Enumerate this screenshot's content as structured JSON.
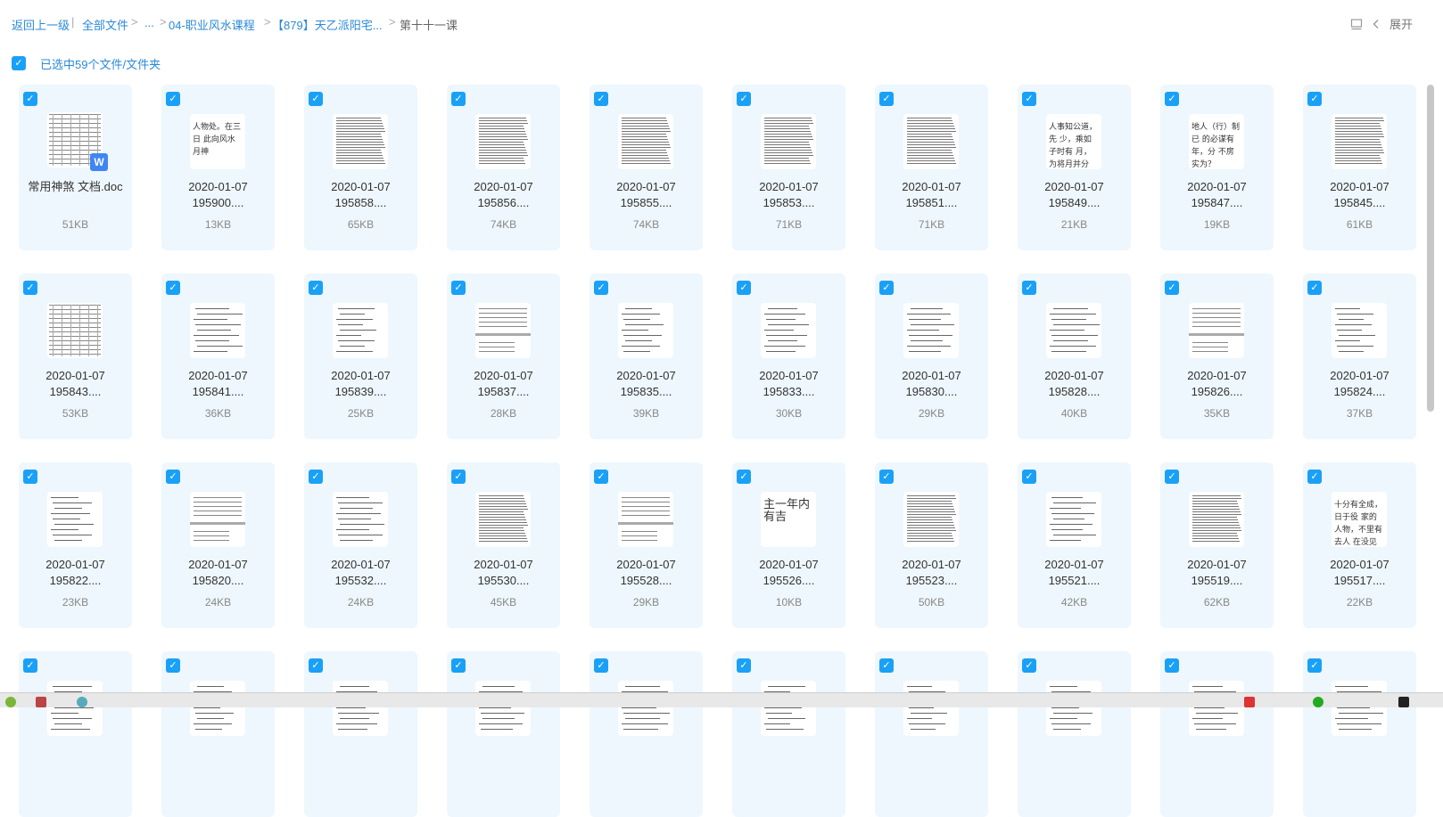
{
  "breadcrumb": {
    "back": "返回上一级",
    "sep1": "|",
    "all_files": "全部文件",
    "ellipsis": "...",
    "folder1": "04-职业风水课程",
    "folder2": "【879】天乙派阳宅...",
    "current": "第十十一课",
    "arrow": ">"
  },
  "header": {
    "expand_label": "展开",
    "layout_icon": "layout-icon",
    "chevron_icon": "chevron-left-icon"
  },
  "selection": {
    "text": "已选中59个文件/文件夹",
    "checked": true
  },
  "files": [
    {
      "name": "常用神煞 文档.doc",
      "size": "51KB",
      "type": "doc",
      "preview": "table"
    },
    {
      "name": "2020-01-07 195900....",
      "size": "13KB",
      "type": "image",
      "preview": "big",
      "text": "人物处。在三日 此向风水月神"
    },
    {
      "name": "2020-01-07 195858....",
      "size": "65KB",
      "type": "image",
      "preview": "dense"
    },
    {
      "name": "2020-01-07 195856....",
      "size": "74KB",
      "type": "image",
      "preview": "dense"
    },
    {
      "name": "2020-01-07 195855....",
      "size": "74KB",
      "type": "image",
      "preview": "dense"
    },
    {
      "name": "2020-01-07 195853....",
      "size": "71KB",
      "type": "image",
      "preview": "dense"
    },
    {
      "name": "2020-01-07 195851....",
      "size": "71KB",
      "type": "image",
      "preview": "dense"
    },
    {
      "name": "2020-01-07 195849....",
      "size": "21KB",
      "type": "image",
      "preview": "big",
      "text": "人事知公道，先 少，乘如子时有 月，为将月并分"
    },
    {
      "name": "2020-01-07 195847....",
      "size": "19KB",
      "type": "image",
      "preview": "big",
      "text": "地人（行）制已 的必谋有年，分 不房实为？"
    },
    {
      "name": "2020-01-07 195845....",
      "size": "61KB",
      "type": "image",
      "preview": "dense"
    },
    {
      "name": "2020-01-07 195843....",
      "size": "53KB",
      "type": "image",
      "preview": "table"
    },
    {
      "name": "2020-01-07 195841....",
      "size": "36KB",
      "type": "image",
      "preview": "sparse"
    },
    {
      "name": "2020-01-07 195839....",
      "size": "25KB",
      "type": "image",
      "preview": "sparse"
    },
    {
      "name": "2020-01-07 195837....",
      "size": "28KB",
      "type": "image",
      "preview": "bar"
    },
    {
      "name": "2020-01-07 195835....",
      "size": "39KB",
      "type": "image",
      "preview": "sparse"
    },
    {
      "name": "2020-01-07 195833....",
      "size": "30KB",
      "type": "image",
      "preview": "sparse"
    },
    {
      "name": "2020-01-07 195830....",
      "size": "29KB",
      "type": "image",
      "preview": "sparse"
    },
    {
      "name": "2020-01-07 195828....",
      "size": "40KB",
      "type": "image",
      "preview": "sparse"
    },
    {
      "name": "2020-01-07 195826....",
      "size": "35KB",
      "type": "image",
      "preview": "bar"
    },
    {
      "name": "2020-01-07 195824....",
      "size": "37KB",
      "type": "image",
      "preview": "sparse"
    },
    {
      "name": "2020-01-07 195822....",
      "size": "23KB",
      "type": "image",
      "preview": "sparse"
    },
    {
      "name": "2020-01-07 195820....",
      "size": "24KB",
      "type": "image",
      "preview": "bar"
    },
    {
      "name": "2020-01-07 195532....",
      "size": "24KB",
      "type": "image",
      "preview": "sparse"
    },
    {
      "name": "2020-01-07 195530....",
      "size": "45KB",
      "type": "image",
      "preview": "dense"
    },
    {
      "name": "2020-01-07 195528....",
      "size": "29KB",
      "type": "image",
      "preview": "bar"
    },
    {
      "name": "2020-01-07 195526....",
      "size": "10KB",
      "type": "image",
      "preview": "big",
      "text": "主一年内有吉"
    },
    {
      "name": "2020-01-07 195523....",
      "size": "50KB",
      "type": "image",
      "preview": "dense"
    },
    {
      "name": "2020-01-07 195521....",
      "size": "42KB",
      "type": "image",
      "preview": "sparse"
    },
    {
      "name": "2020-01-07 195519....",
      "size": "62KB",
      "type": "image",
      "preview": "dense"
    },
    {
      "name": "2020-01-07 195517....",
      "size": "22KB",
      "type": "image",
      "preview": "big",
      "text": "十分有全成，日于役 家的人物，不里有去人 在没见之，则在出现"
    },
    {
      "name": "",
      "size": "",
      "type": "image",
      "preview": "sparse"
    },
    {
      "name": "",
      "size": "",
      "type": "image",
      "preview": "sparse"
    },
    {
      "name": "",
      "size": "",
      "type": "image",
      "preview": "sparse"
    },
    {
      "name": "",
      "size": "",
      "type": "image",
      "preview": "sparse"
    },
    {
      "name": "",
      "size": "",
      "type": "image",
      "preview": "sparse"
    },
    {
      "name": "",
      "size": "",
      "type": "image",
      "preview": "sparse"
    },
    {
      "name": "",
      "size": "",
      "type": "image",
      "preview": "sparse"
    },
    {
      "name": "",
      "size": "",
      "type": "image",
      "preview": "sparse"
    },
    {
      "name": "",
      "size": "",
      "type": "image",
      "preview": "sparse"
    },
    {
      "name": "",
      "size": "",
      "type": "image",
      "preview": "sparse"
    }
  ],
  "icons": {
    "checkbox": "checkbox-checked-icon",
    "word": "word-doc-icon"
  },
  "colors": {
    "accent": "#1aa1f7",
    "link": "#2b89d9",
    "card_bg": "#eef7fd",
    "word_blue": "#3f86f5"
  }
}
